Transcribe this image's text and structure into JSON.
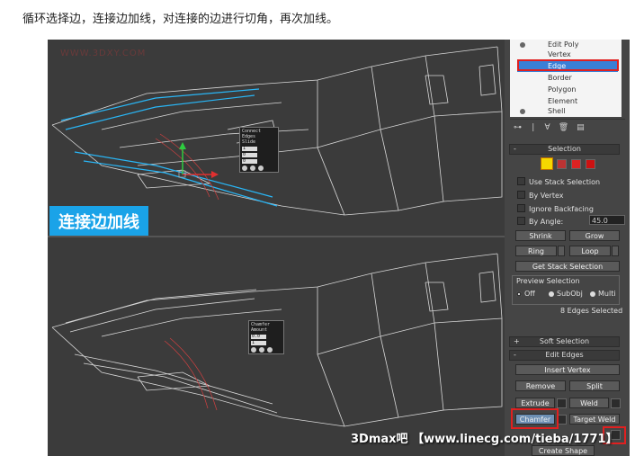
{
  "caption": "循环选择边，连接边加线，对连接的边进行切角，再次加线。",
  "watermark": "WWW.3DXY.COM",
  "banner": "连接边加线",
  "caddy_top": {
    "title1": "Connect Edges",
    "title2": "Slide",
    "v1": "1",
    "v2": "0",
    "v3": "0"
  },
  "caddy_bottom": {
    "title1": "Chamfer",
    "title2": "Amount",
    "v1": "0.0",
    "v2": "1"
  },
  "modifier_stack": {
    "items": [
      "Edit Poly",
      "Vertex",
      "Edge",
      "Border",
      "Polygon",
      "Element",
      "Shell"
    ],
    "selected": "Edge"
  },
  "selection": {
    "header": "Selection",
    "use_stack": "Use Stack Selection",
    "by_vertex": "By Vertex",
    "ignore_backfacing": "Ignore Backfacing",
    "by_angle": "By Angle:",
    "angle_value": "45.0",
    "shrink": "Shrink",
    "grow": "Grow",
    "ring": "Ring",
    "loop": "Loop",
    "get_stack": "Get Stack Selection",
    "preview": "Preview Selection",
    "off": "Off",
    "subobj": "SubObj",
    "multi": "Multi",
    "status": "8 Edges Selected"
  },
  "soft_selection": "Soft Selection",
  "edit_edges": {
    "header": "Edit Edges",
    "insert_vertex": "Insert Vertex",
    "remove": "Remove",
    "split": "Split",
    "extrude": "Extrude",
    "weld": "Weld",
    "chamfer": "Chamfer",
    "target_weld": "Target Weld",
    "create_shape": "Create Shape"
  },
  "credit": "3Dmax吧 【www.linecg.com/tieba/1771】",
  "colors": {
    "highlight_edges": "#29b6f6",
    "red_outline": "#e02020",
    "banner_bg": "#1aa3e8",
    "stack_selected": "#3a7fd6"
  }
}
